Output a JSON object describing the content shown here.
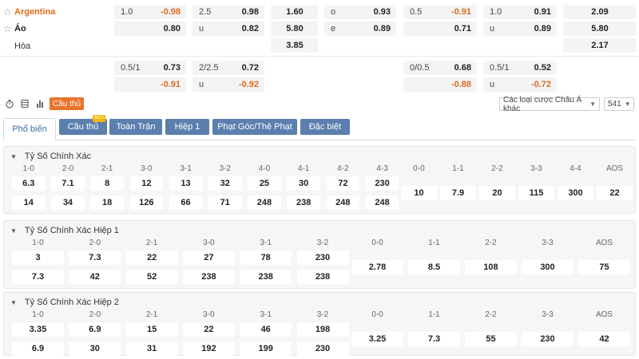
{
  "match": {
    "teams": [
      {
        "name": "Argentina"
      },
      {
        "name": "Áo"
      },
      {
        "name": "Hòa"
      }
    ]
  },
  "odds_top": {
    "row1": [
      {
        "l": "1.0",
        "v": "-0.98"
      },
      {
        "l": "2.5",
        "v": "0.98"
      },
      {
        "l": "",
        "v": "1.60"
      },
      {
        "l": "o",
        "v": "0.93"
      },
      {
        "l": "0.5",
        "v": "-0.91"
      },
      {
        "l": "1.0",
        "v": "0.91"
      },
      {
        "l": "",
        "v": "2.09"
      }
    ],
    "row2": [
      {
        "l": "",
        "v": "0.80"
      },
      {
        "l": "u",
        "v": "0.82"
      },
      {
        "l": "",
        "v": "5.80"
      },
      {
        "l": "e",
        "v": "0.89"
      },
      {
        "l": "",
        "v": "0.71"
      },
      {
        "l": "u",
        "v": "0.89"
      },
      {
        "l": "",
        "v": "5.80"
      }
    ],
    "row3": [
      {
        "l": "",
        "v": "3.85"
      },
      {
        "l": "",
        "v": "2.17"
      }
    ],
    "row4": [
      {
        "l": "0.5/1",
        "v": "0.73"
      },
      {
        "l": "2/2.5",
        "v": "0.72"
      },
      {
        "l": "0/0.5",
        "v": "0.68"
      },
      {
        "l": "0.5/1",
        "v": "0.52"
      }
    ],
    "row5": [
      {
        "l": "",
        "v": "-0.91"
      },
      {
        "l": "u",
        "v": "-0.92"
      },
      {
        "l": "",
        "v": "-0.88"
      },
      {
        "l": "u",
        "v": "-0.72"
      }
    ]
  },
  "toolbar": {
    "icons": [
      "timer-icon",
      "list-icon",
      "chart-icon"
    ],
    "player_btn": "Cầu thủ",
    "market_select": "Các loại cược Châu Á khác",
    "count_select": "541"
  },
  "tabs": [
    {
      "label": "Phổ biến",
      "active": true
    },
    {
      "label": "Cầu thủ",
      "badge": "MỚI"
    },
    {
      "label": "Toàn Trận"
    },
    {
      "label": "Hiệp 1"
    },
    {
      "label": "Phạt Góc/Thẻ Phạt"
    },
    {
      "label": "Đặc biệt"
    }
  ],
  "sections": [
    {
      "title": "Tỷ Số Chính Xác",
      "home_scores": [
        "1-0",
        "2-0",
        "2-1",
        "3-0",
        "3-1",
        "3-2",
        "4-0",
        "4-1",
        "4-2",
        "4-3"
      ],
      "home_odds": [
        "6.3",
        "7.1",
        "8",
        "12",
        "13",
        "32",
        "25",
        "30",
        "72",
        "230"
      ],
      "away_odds": [
        "14",
        "34",
        "18",
        "126",
        "66",
        "71",
        "248",
        "238",
        "248",
        "248"
      ],
      "draw_scores": [
        "0-0",
        "1-1",
        "2-2",
        "3-3",
        "4-4",
        "AOS"
      ],
      "draw_odds": [
        "10",
        "7.9",
        "20",
        "115",
        "300",
        "22"
      ]
    },
    {
      "title": "Tỷ Số Chính Xác Hiệp 1",
      "home_scores": [
        "1-0",
        "2-0",
        "2-1",
        "3-0",
        "3-1",
        "3-2"
      ],
      "home_odds": [
        "3",
        "7.3",
        "22",
        "27",
        "78",
        "230"
      ],
      "away_odds": [
        "7.3",
        "42",
        "52",
        "238",
        "238",
        "238"
      ],
      "draw_scores": [
        "0-0",
        "1-1",
        "2-2",
        "3-3",
        "AOS"
      ],
      "draw_odds": [
        "2.78",
        "8.5",
        "108",
        "300",
        "75"
      ]
    },
    {
      "title": "Tỷ Số Chính Xác Hiệp 2",
      "home_scores": [
        "1-0",
        "2-0",
        "2-1",
        "3-0",
        "3-1",
        "3-2"
      ],
      "home_odds": [
        "3.35",
        "6.9",
        "15",
        "22",
        "46",
        "198"
      ],
      "away_odds": [
        "6.9",
        "30",
        "31",
        "192",
        "199",
        "230"
      ],
      "draw_scores": [
        "0-0",
        "1-1",
        "2-2",
        "3-3",
        "AOS"
      ],
      "draw_odds": [
        "3.25",
        "7.3",
        "55",
        "230",
        "42"
      ]
    }
  ],
  "colors": {
    "accent": "#e36b15",
    "negative": "#e06b1a",
    "tab_bg": "#5b7fae",
    "tab_active_text": "#3a6ea5"
  }
}
